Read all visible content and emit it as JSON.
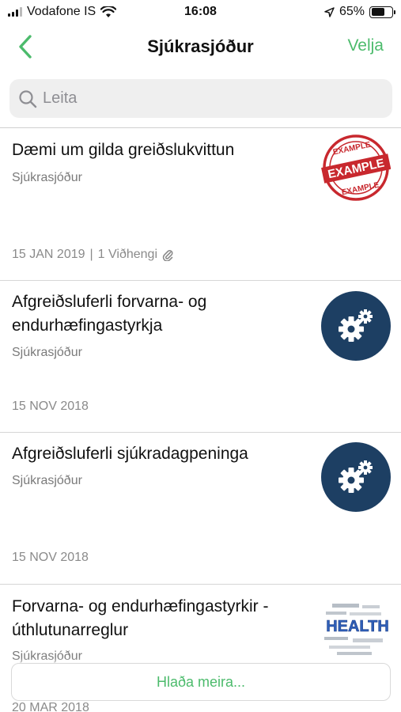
{
  "status_bar": {
    "carrier": "Vodafone IS",
    "time": "16:08",
    "battery": "65%",
    "battery_level": 0.65,
    "icons": [
      "signal-icon",
      "wifi-icon",
      "location-arrow-icon",
      "battery-icon"
    ]
  },
  "nav": {
    "back_icon": "chevron-left-icon",
    "title": "Sjúkrasjóður",
    "action": "Velja"
  },
  "search": {
    "placeholder": "Leita",
    "value": "",
    "icon": "search-icon"
  },
  "items": [
    {
      "title": "Dæmi um gilda greiðslukvittun",
      "subtitle": "Sjúkrasjóður",
      "date": "15 JAN 2019",
      "separator": "|",
      "attachments": "1 Viðhengi",
      "thumb_icon": "example-stamp-icon",
      "stamp_text": "EXAMPLE"
    },
    {
      "title": "Afgreiðsluferli forvarna- og endurhæfingastyrkja",
      "subtitle": "Sjúkrasjóður",
      "date": "15 NOV 2018",
      "thumb_icon": "gears-icon"
    },
    {
      "title": "Afgreiðsluferli sjúkradagpeninga",
      "subtitle": "Sjúkrasjóður",
      "date": "15 NOV 2018",
      "thumb_icon": "gears-icon"
    },
    {
      "title": "Forvarna- og endurhæfingastyrkir - úthlutunarreglur",
      "subtitle": "Sjúkrasjóður",
      "date": "20 MAR 2018",
      "thumb_icon": "health-wordcloud-icon",
      "thumb_text": "HEALTH"
    }
  ],
  "load_more": "Hlaða meira...",
  "colors": {
    "accent": "#4cbb6c",
    "gear_bg": "#1d3f63",
    "stamp_red": "#c8282e"
  }
}
